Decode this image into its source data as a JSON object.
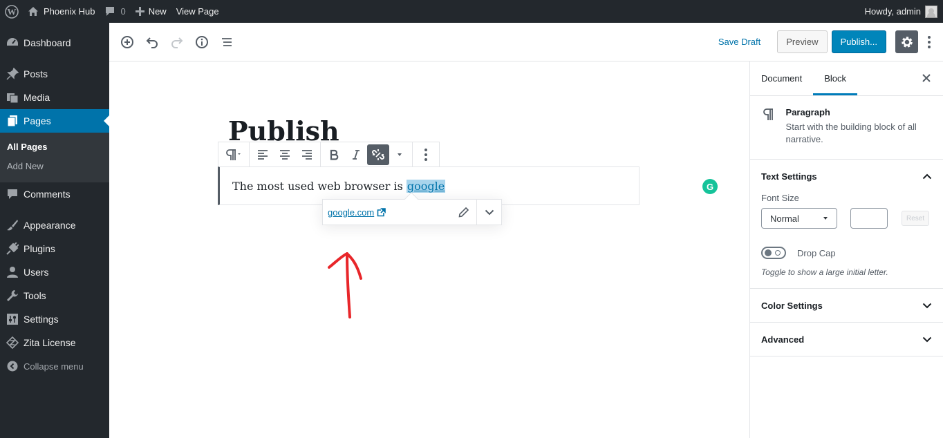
{
  "adminbar": {
    "site_name": "Phoenix Hub",
    "comments_count": "0",
    "new_label": "New",
    "view_page_label": "View Page",
    "howdy": "Howdy, admin"
  },
  "sidebar": {
    "items": [
      {
        "label": "Dashboard",
        "icon": "dashboard-icon"
      },
      {
        "label": "Posts",
        "icon": "pin-icon"
      },
      {
        "label": "Media",
        "icon": "media-icon"
      },
      {
        "label": "Pages",
        "icon": "pages-icon"
      },
      {
        "label": "Comments",
        "icon": "comments-icon"
      },
      {
        "label": "Appearance",
        "icon": "brush-icon"
      },
      {
        "label": "Plugins",
        "icon": "plug-icon"
      },
      {
        "label": "Users",
        "icon": "users-icon"
      },
      {
        "label": "Tools",
        "icon": "wrench-icon"
      },
      {
        "label": "Settings",
        "icon": "settings-sliders-icon"
      },
      {
        "label": "Zita License",
        "icon": "zita-icon"
      }
    ],
    "submenu": [
      "All Pages",
      "Add New"
    ],
    "collapse_label": "Collapse menu"
  },
  "header": {
    "save_draft": "Save Draft",
    "preview": "Preview",
    "publish": "Publish..."
  },
  "post": {
    "title": "Publish",
    "paragraph_text": "The most used web browser is ",
    "link_text": "google",
    "link_url": "google.com"
  },
  "settings": {
    "tabs": [
      "Document",
      "Block"
    ],
    "active_tab": "Block",
    "block": {
      "name": "Paragraph",
      "description": "Start with the building block of all narrative."
    },
    "text_settings": {
      "title": "Text Settings",
      "font_size_label": "Font Size",
      "font_size_value": "Normal",
      "reset_label": "Reset",
      "drop_cap_label": "Drop Cap",
      "drop_cap_help": "Toggle to show a large initial letter."
    },
    "color_settings_title": "Color Settings",
    "advanced_title": "Advanced"
  },
  "colors": {
    "accent": "#0073aa",
    "admin_dark": "#23282d",
    "publish": "#0085ba",
    "annotation": "#e8262a",
    "grammarly": "#15c39a"
  }
}
